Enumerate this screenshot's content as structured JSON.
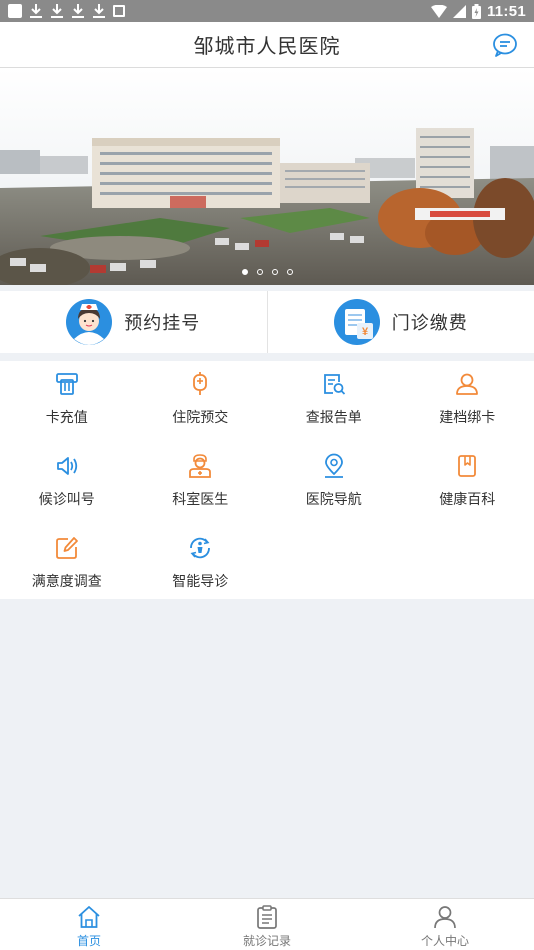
{
  "status_bar": {
    "time": "11:51",
    "icons": [
      "app-square-icon",
      "download-icon",
      "download-icon",
      "download-icon",
      "download-icon",
      "image-icon",
      "wifi-icon",
      "signal-icon",
      "battery-icon"
    ]
  },
  "header": {
    "title": "邹城市人民医院",
    "message_icon": "chat-bubble-icon"
  },
  "banner": {
    "slide_count": 4,
    "active_index": 0
  },
  "quick_entries": [
    {
      "label": "预约挂号",
      "icon": "nurse-avatar-icon"
    },
    {
      "label": "门诊缴费",
      "icon": "bill-payment-icon"
    }
  ],
  "grid": [
    {
      "label": "卡充值",
      "icon": "card-recharge-icon",
      "color": "#2b8fe0"
    },
    {
      "label": "住院预交",
      "icon": "iv-drip-icon",
      "color": "#f28a3a"
    },
    {
      "label": "查报告单",
      "icon": "report-search-icon",
      "color": "#2b8fe0"
    },
    {
      "label": "建档绑卡",
      "icon": "user-profile-icon",
      "color": "#f28a3a"
    },
    {
      "label": "候诊叫号",
      "icon": "speaker-icon",
      "color": "#2b8fe0"
    },
    {
      "label": "科室医生",
      "icon": "doctor-icon",
      "color": "#f28a3a"
    },
    {
      "label": "医院导航",
      "icon": "location-pin-icon",
      "color": "#2b8fe0"
    },
    {
      "label": "健康百科",
      "icon": "book-icon",
      "color": "#f28a3a"
    },
    {
      "label": "满意度调查",
      "icon": "edit-survey-icon",
      "color": "#f28a3a"
    },
    {
      "label": "智能导诊",
      "icon": "smart-guide-icon",
      "color": "#2b8fe0"
    }
  ],
  "bottom_nav": [
    {
      "label": "首页",
      "icon": "home-icon",
      "active": true
    },
    {
      "label": "就诊记录",
      "icon": "clipboard-icon",
      "active": false
    },
    {
      "label": "个人中心",
      "icon": "person-icon",
      "active": false
    }
  ],
  "colors": {
    "accent_blue": "#2b8fe0",
    "accent_orange": "#f28a3a",
    "background": "#eef1f5"
  }
}
